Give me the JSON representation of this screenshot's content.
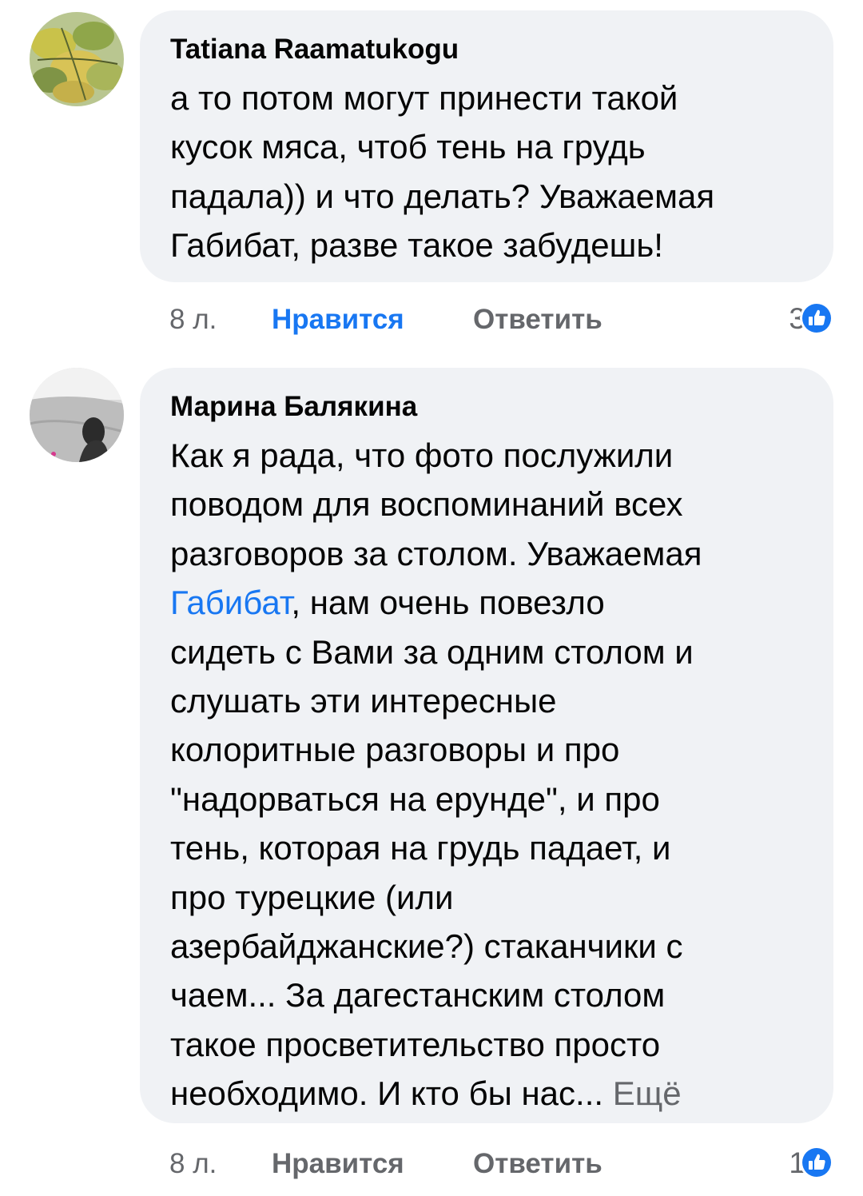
{
  "comments": [
    {
      "author": "Tatiana Raamatukogu",
      "lines": [
        "а то потом могут принести такой",
        "кусок мяса, чтоб тень на грудь",
        "падала)) и что делать? Уважаемая",
        "Габибат, разве такое забудешь!"
      ],
      "time": "8 л.",
      "like_label": "Нравится",
      "like_active": true,
      "reply_label": "Ответить",
      "reaction_count": "3",
      "reaction_icon": "like-reaction-icon"
    },
    {
      "author": "Марина Балякина",
      "lines_before_mention": [
        "Как я рада, что фото послужили",
        "поводом для воспоминаний всех",
        "разговоров за столом. Уважаемая"
      ],
      "mention": "Габибат",
      "mention_tail": ", нам очень повезло",
      "lines_after_mention": [
        "сидеть с Вами за одним столом и",
        "слушать эти интересные",
        "колоритные разговоры и про",
        "\"надорваться на ерунде\", и про",
        "тень, которая на грудь падает, и",
        "про турецкие (или",
        "азербайджанские?) стаканчики с",
        "чаем... За дагестанским столом",
        "такое просветительство просто"
      ],
      "last_line": "необходимо. И кто бы нас...",
      "more_label": "Ещё",
      "time": "8 л.",
      "like_label": "Нравится",
      "like_active": false,
      "reply_label": "Ответить",
      "reaction_count": "1",
      "reaction_icon": "like-reaction-icon"
    }
  ],
  "colors": {
    "bubble": "#f0f2f5",
    "link": "#1877f2",
    "secondary_text": "#65676b",
    "primary_text": "#050505"
  }
}
